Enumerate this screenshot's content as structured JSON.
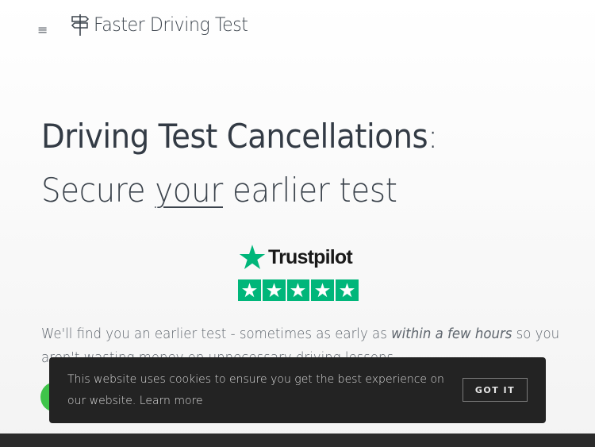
{
  "header": {
    "menu_icon": "hamburger-icon",
    "menu_glyph": "≡",
    "brand_icon": "signpost-icon",
    "brand_name": "Faster Driving Test"
  },
  "hero": {
    "title": "Driving Test Cancellations",
    "title_colon": ":",
    "subtitle_before": "Secure ",
    "subtitle_emphasis": "your",
    "subtitle_after": " earlier test"
  },
  "trustpilot": {
    "icon": "trustpilot-star-icon",
    "wordmark": "Trustpilot",
    "rating_stars": 5,
    "brand_color": "#00b67a"
  },
  "lede": {
    "before": "We'll find you an earlier test - sometimes as early as ",
    "emphasis": "within a few hours",
    "after": " so you aren't wasting money on unnecessary driving lessons."
  },
  "cookie_banner": {
    "message": "This website uses cookies to ensure you get the best experience on our website.",
    "learn_more": "Learn more",
    "button": "GOT IT"
  },
  "colors": {
    "cta_green": "#3fc44a",
    "banner_bg": "#232323",
    "text_dark": "#333b45"
  }
}
